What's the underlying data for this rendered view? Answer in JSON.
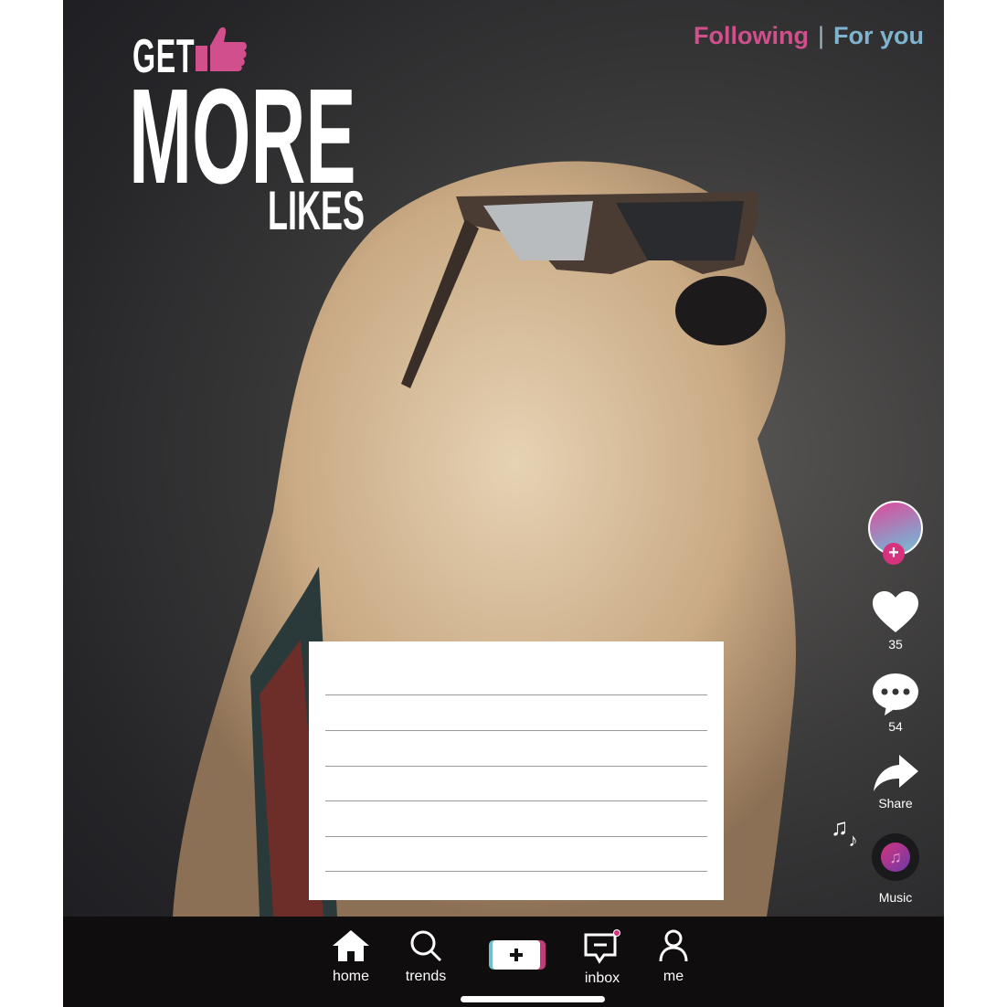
{
  "headline": {
    "line1": "GET",
    "line2": "MORE",
    "line3": "LIKES"
  },
  "top_tabs": {
    "following": "Following",
    "separator": "|",
    "for_you": "For you"
  },
  "side_actions": {
    "likes_count": "35",
    "comments_count": "54",
    "share_label": "Share",
    "music_label": "Music"
  },
  "bottom_nav": {
    "home": "home",
    "trends": "trends",
    "inbox": "inbox",
    "me": "me"
  },
  "colors": {
    "pink": "#d6337f",
    "teal": "#7fb4cf",
    "bar": "#0f0d0e"
  },
  "icons": [
    "thumbs-up-icon",
    "heart-icon",
    "comment-icon",
    "share-icon",
    "music-note-icon",
    "home-icon",
    "search-icon",
    "plus-icon",
    "inbox-icon",
    "user-icon"
  ]
}
